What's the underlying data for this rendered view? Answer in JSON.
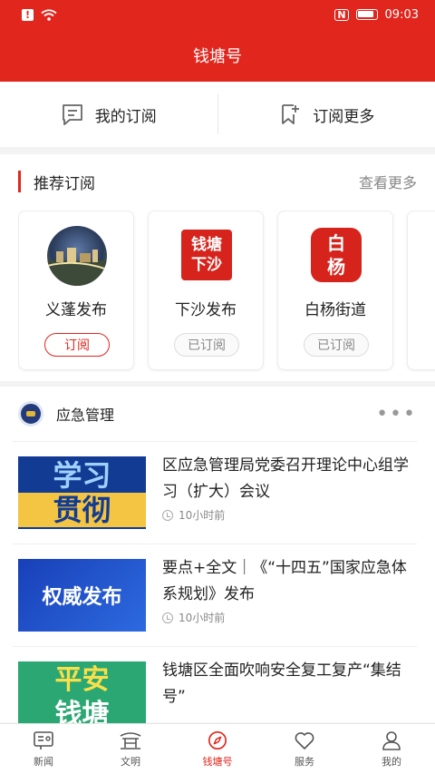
{
  "status_bar": {
    "time": "09:03",
    "nfc": "N"
  },
  "app_title": "钱塘号",
  "sub_nav": {
    "my_subscriptions": "我的订阅",
    "subscribe_more": "订阅更多"
  },
  "recommend": {
    "title": "推荐订阅",
    "more": "查看更多",
    "cards": [
      {
        "name": "义蓬发布",
        "button": "订阅"
      },
      {
        "name": "下沙发布",
        "button": "已订阅",
        "logo_text_1": "钱塘",
        "logo_text_2": "下沙"
      },
      {
        "name": "白杨街道",
        "button": "已订阅",
        "logo_text_1": "白",
        "logo_text_2": "杨"
      }
    ]
  },
  "news": {
    "source": "应急管理",
    "more": "•••",
    "items": [
      {
        "headline": "区应急管理局党委召开理论中心组学习（扩大）会议",
        "time": "10小时前",
        "thumb_row1": "学习",
        "thumb_row2": "贯彻"
      },
      {
        "headline": "要点+全文｜《“十四五”国家应急体系规划》发布",
        "time": "10小时前",
        "thumb_text": "权威发布"
      },
      {
        "headline": "钱塘区全面吹响安全复工复产“集结号”",
        "thumb_row1": "平安",
        "thumb_row2": "钱塘"
      }
    ]
  },
  "tabs": [
    {
      "label": "新闻"
    },
    {
      "label": "文明"
    },
    {
      "label": "钱塘号"
    },
    {
      "label": "服务"
    },
    {
      "label": "我的"
    }
  ],
  "colors": {
    "brand": "#e1261d"
  }
}
